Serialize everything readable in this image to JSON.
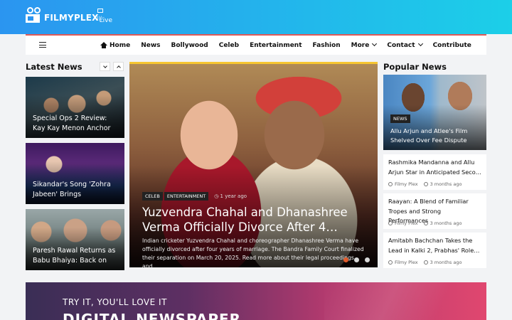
{
  "brand": {
    "name": "FILMYPLEX",
    "suffix": "Live"
  },
  "nav": {
    "items": [
      {
        "label": "Home"
      },
      {
        "label": "News"
      },
      {
        "label": "Bollywood"
      },
      {
        "label": "Celeb"
      },
      {
        "label": "Entertainment"
      },
      {
        "label": "Fashion"
      },
      {
        "label": "More"
      },
      {
        "label": "Contact"
      },
      {
        "label": "Contribute"
      }
    ]
  },
  "latest": {
    "title": "Latest News",
    "cards": [
      {
        "caption": "Special Ops 2 Review: Kay Kay Menon Anchor"
      },
      {
        "caption": "Sikandar's Song 'Zohra Jabeen' Brings"
      },
      {
        "caption": "Paresh Rawal Returns as Babu Bhaiya: Back on"
      }
    ]
  },
  "hero": {
    "tags": [
      "CELEB",
      "ENTERTAINMENT"
    ],
    "time": "1 year ago",
    "title": "Yuzvendra Chahal and Dhanashree Verma Officially Divorce After 4…",
    "description": "Indian cricketer Yuzvendra Chahal and choreographer Dhanashree Verma have officially divorced after four years of marriage. The Bandra Family Court finalized their separation on March 20, 2025. Read more about their legal proceedings and…",
    "slides": 3,
    "active_slide": 1
  },
  "popular": {
    "title": "Popular News",
    "featured": {
      "tag": "NEWS",
      "caption": "Allu Arjun and Atlee's Film Shelved Over Fee Dispute"
    },
    "items": [
      {
        "title": "Rashmika Mandanna and Allu Arjun Star in Anticipated Seco…",
        "author": "Filmy Plex",
        "time": "3 months ago"
      },
      {
        "title": "Raayan: A Blend of Familiar Tropes and Strong Performances",
        "author": "Filmy Plex",
        "time": "3 months ago"
      },
      {
        "title": "Amitabh Bachchan Takes the Lead in Kalki 2, Prabhas' Role…",
        "author": "Filmy Plex",
        "time": "3 months ago"
      }
    ]
  },
  "banner": {
    "subtitle": "TRY IT, YOU'LL LOVE IT",
    "title": "DIGITAL NEWSPAPER"
  },
  "colors": {
    "header_start": "#2b95f0",
    "header_end": "#1ccfe8",
    "nav_accent": "#e05a57",
    "hero_accent": "#f6c531",
    "slider_active": "#e05a2a"
  }
}
